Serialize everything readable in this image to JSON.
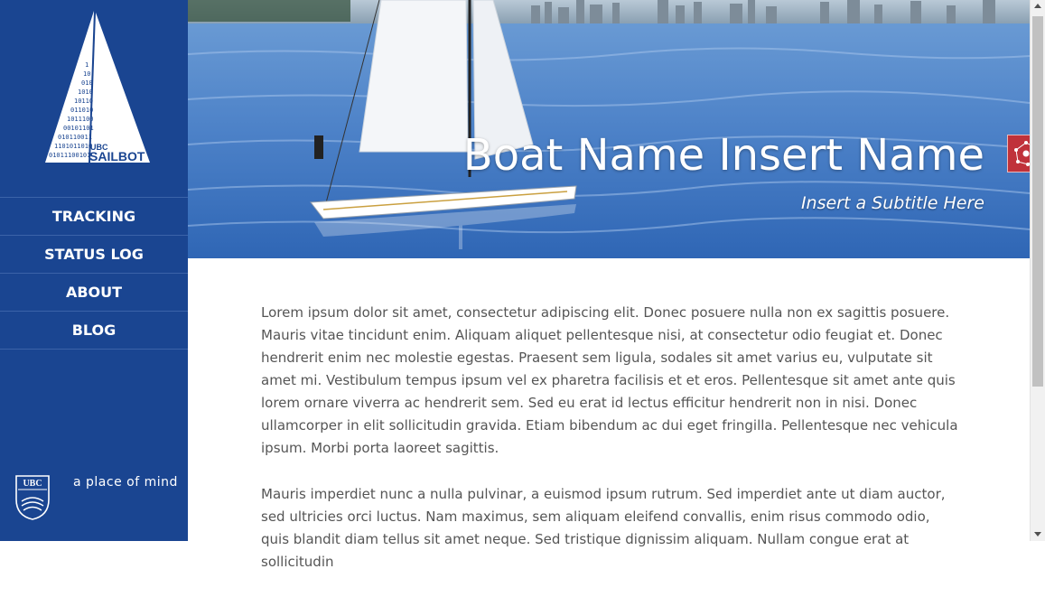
{
  "logo": {
    "small_text": "UBC",
    "brand_text": "SAILBOT"
  },
  "nav": {
    "items": [
      {
        "label": "TRACKING"
      },
      {
        "label": "STATUS LOG"
      },
      {
        "label": "ABOUT"
      },
      {
        "label": "BLOG"
      }
    ]
  },
  "footer": {
    "crest_text": "UBC",
    "tagline": "a place of mind"
  },
  "hero": {
    "title": "Boat Name Insert Name",
    "subtitle": "Insert a Subtitle Here"
  },
  "content": {
    "paragraphs": [
      "Lorem ipsum dolor sit amet, consectetur adipiscing elit. Donec posuere nulla non ex sagittis posuere. Mauris vitae tincidunt enim. Aliquam aliquet pellentesque nisi, at consectetur odio feugiat et. Donec hendrerit enim nec molestie egestas. Praesent sem ligula, sodales sit amet varius eu, vulputate sit amet mi. Vestibulum tempus ipsum vel ex pharetra facilisis et et eros. Pellentesque sit amet ante quis lorem ornare viverra ac hendrerit sem. Sed eu erat id lectus efficitur hendrerit non in nisi. Donec ullamcorper in elit sollicitudin gravida. Etiam bibendum ac dui eget fringilla. Pellentesque nec vehicula ipsum. Morbi porta laoreet sagittis.",
      "Mauris imperdiet nunc a nulla pulvinar, a euismod ipsum rutrum. Sed imperdiet ante ut diam auctor, sed ultricies orci luctus. Nam maximus, sem aliquam eleifend convallis, enim risus commodo odio, quis blandit diam tellus sit amet neque. Sed tristique dignissim aliquam. Nullam congue erat at sollicitudin"
    ]
  },
  "colors": {
    "sidebar": "#1a4591",
    "extension_button": "#c0323a",
    "body_text": "#555555"
  },
  "icons": {
    "extension": "network-graph-icon",
    "crest": "ubc-crest-icon"
  }
}
